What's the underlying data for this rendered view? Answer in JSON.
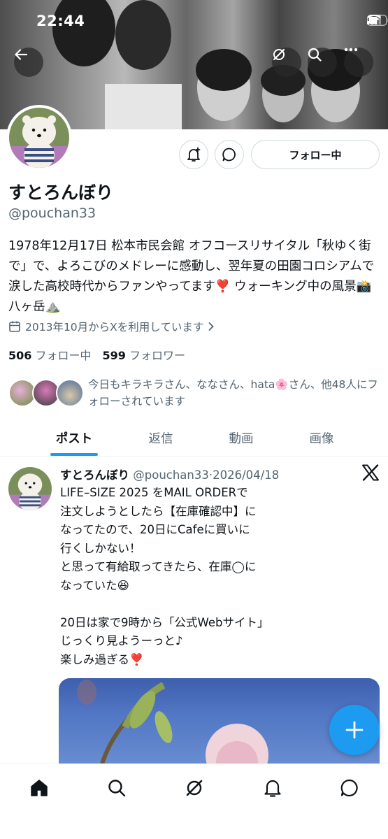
{
  "status_bar": {
    "time": "22:44"
  },
  "profile": {
    "display_name": "すとろんぼり",
    "handle": "@pouchan33",
    "bio": "1978年12月17日 松本市民会館 オフコースリサイタル「秋ゆく街で」で、よろこびのメドレーに感動し、翌年夏の田園コロシアムで涙した高校時代からファンやってます❣️ ウォーキング中の風景📸八ヶ岳⛰️",
    "joined": "2013年10月からXを利用しています",
    "following_count": "506",
    "following_label": "フォロー中",
    "followers_count": "599",
    "followers_label": "フォロワー",
    "known_followers_text": "今日もキラキラさん、ななさん、hata🌸さん、他48人にフォローされています",
    "follow_button_label": "フォロー中"
  },
  "tabs": [
    {
      "label": "ポスト",
      "active": true
    },
    {
      "label": "返信",
      "active": false
    },
    {
      "label": "動画",
      "active": false
    },
    {
      "label": "画像",
      "active": false
    }
  ],
  "post": {
    "author_name": "すとろんぼり",
    "author_meta": "@pouchan33·2026/04/18",
    "text": "LIFE–SIZE 2025 をMAIL ORDERで\n注文しようとしたら【在庫確認中】に\nなってたので、20日にCafeに買いに\n行くしかない！\nと思って有給取ってきたら、在庫◯に\nなっていた😆\n\n20日は家で9時から「公式Webサイト」\nじっくり見ようーっと♪\n楽しみ過ぎる❣️"
  },
  "colors": {
    "accent": "#1d9bf0",
    "text": "#0f1419",
    "muted": "#536471",
    "border": "#cfd9de"
  },
  "icons": {
    "back": "arrow-left-icon",
    "grok": "grok-icon",
    "search": "search-icon",
    "more": "more-icon",
    "notify": "bell-plus-icon",
    "message": "message-icon",
    "calendar": "calendar-icon",
    "home": "home-icon",
    "nav_search": "search-icon",
    "nav_grok": "grok-icon",
    "notifications": "bell-icon",
    "messages": "message-icon",
    "compose": "plus-icon",
    "x_logo": "x-logo-icon"
  }
}
